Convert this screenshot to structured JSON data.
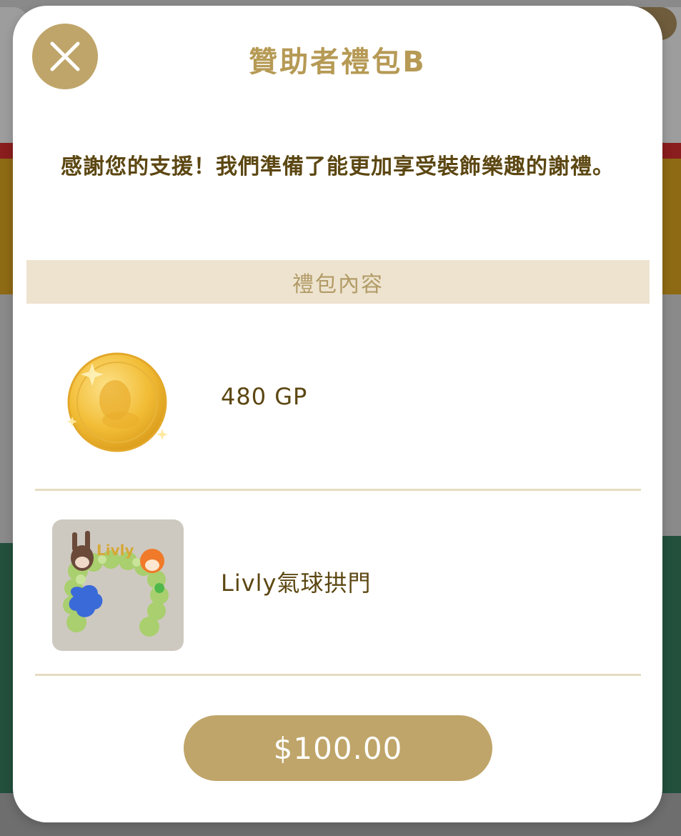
{
  "modal": {
    "title": "贊助者禮包B",
    "message": "感謝您的支援！我們準備了能更加享受裝飾樂趣的謝禮。",
    "section_header": "禮包內容",
    "items": [
      {
        "label": "480 GP",
        "icon": "gold-coin-icon"
      },
      {
        "label": "Livly氣球拱門",
        "icon": "livly-balloon-arch-image",
        "image_text": "Livly"
      }
    ],
    "price": "$100.00",
    "close_icon": "close-icon"
  },
  "colors": {
    "accent": "#bfa56a",
    "title": "#b69a55",
    "text": "#5c4712",
    "section_bg": "#ede3cf",
    "divider": "#e6dcc2"
  }
}
